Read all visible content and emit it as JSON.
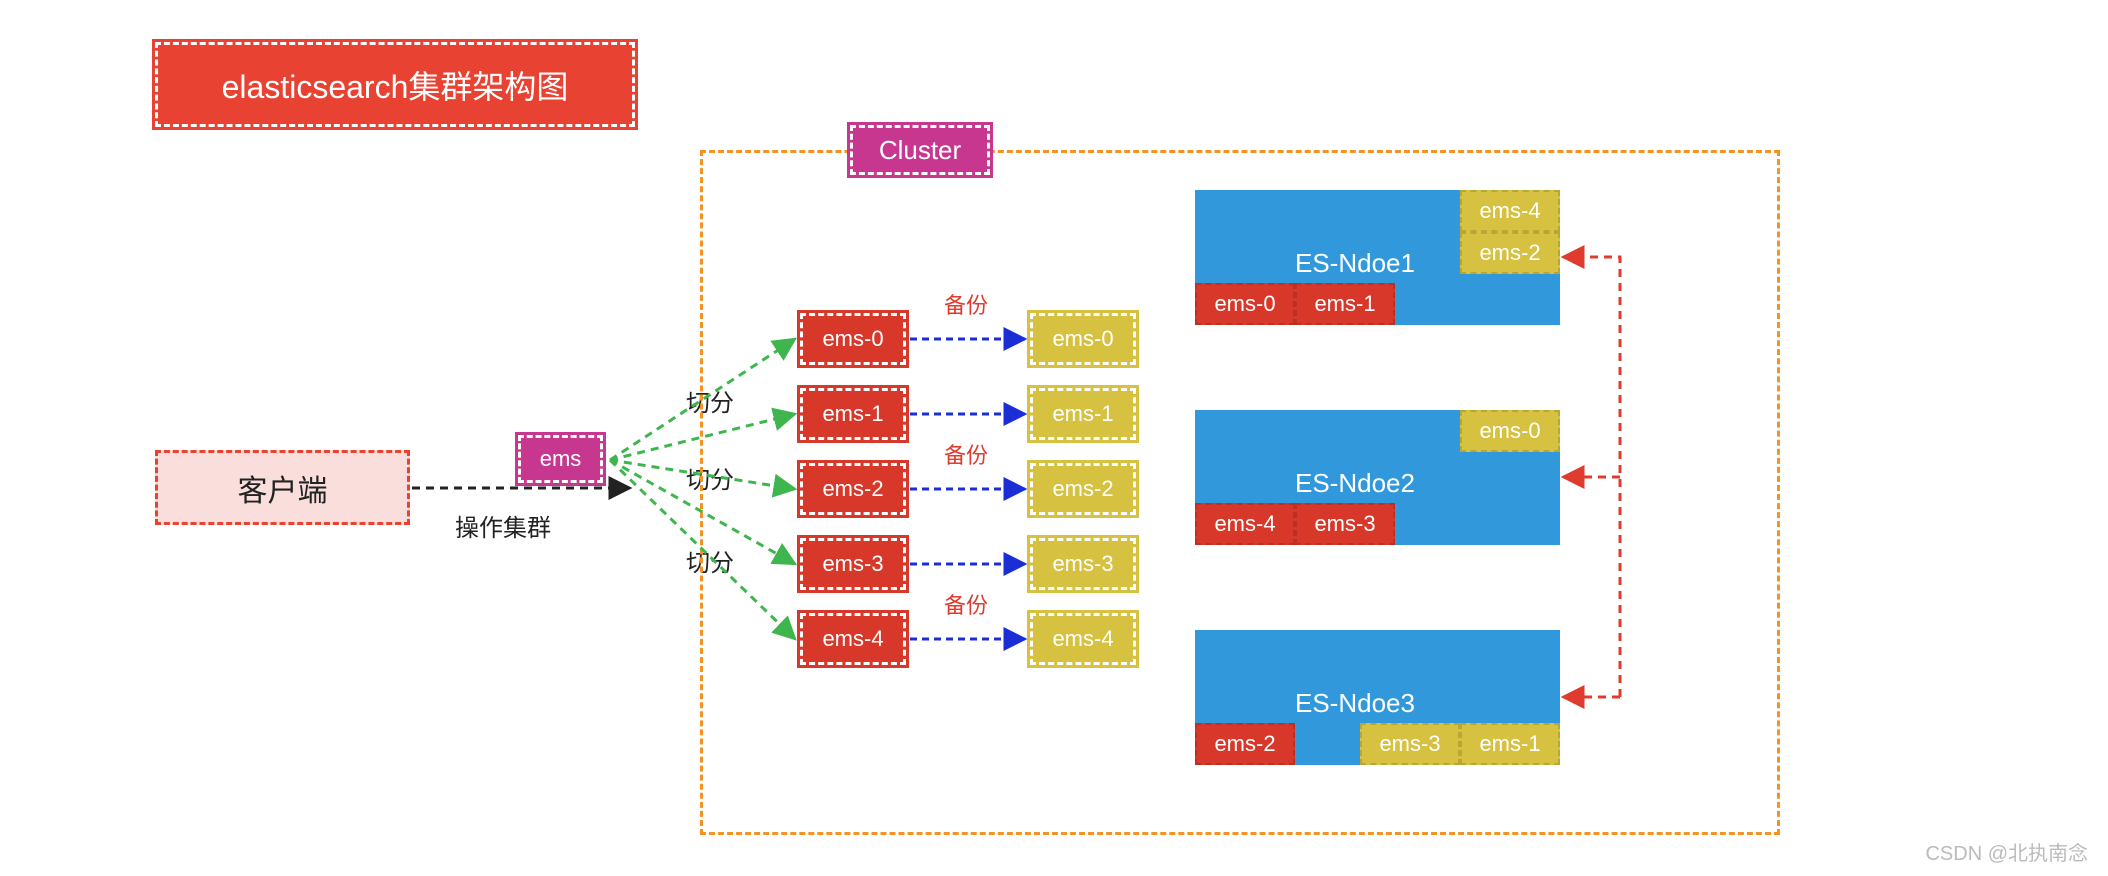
{
  "title": "elasticsearch集群架构图",
  "client": "客户端",
  "ems": "ems",
  "operate_label": "操作集群",
  "split_label": "切分",
  "backup_label": "备份",
  "cluster_label": "Cluster",
  "primary_shards": [
    "ems-0",
    "ems-1",
    "ems-2",
    "ems-3",
    "ems-4"
  ],
  "replica_shards": [
    "ems-0",
    "ems-1",
    "ems-2",
    "ems-3",
    "ems-4"
  ],
  "nodes": [
    {
      "name": "ES-Ndoe1",
      "primaries": [
        "ems-0",
        "ems-1"
      ],
      "replicas": [
        "ems-4",
        "ems-2"
      ]
    },
    {
      "name": "ES-Ndoe2",
      "primaries": [
        "ems-4",
        "ems-3"
      ],
      "replicas": [
        "ems-0"
      ]
    },
    {
      "name": "ES-Ndoe3",
      "primaries": [
        "ems-2"
      ],
      "replicas": [
        "ems-3",
        "ems-1"
      ]
    }
  ],
  "watermark": "CSDN @北执南念",
  "colors": {
    "red": "#d7382a",
    "yellow": "#d6c141",
    "blue": "#3199db",
    "pink": "#c73790",
    "orange": "#f39323",
    "green": "#3fb64d",
    "navy": "#1b2ed6"
  }
}
